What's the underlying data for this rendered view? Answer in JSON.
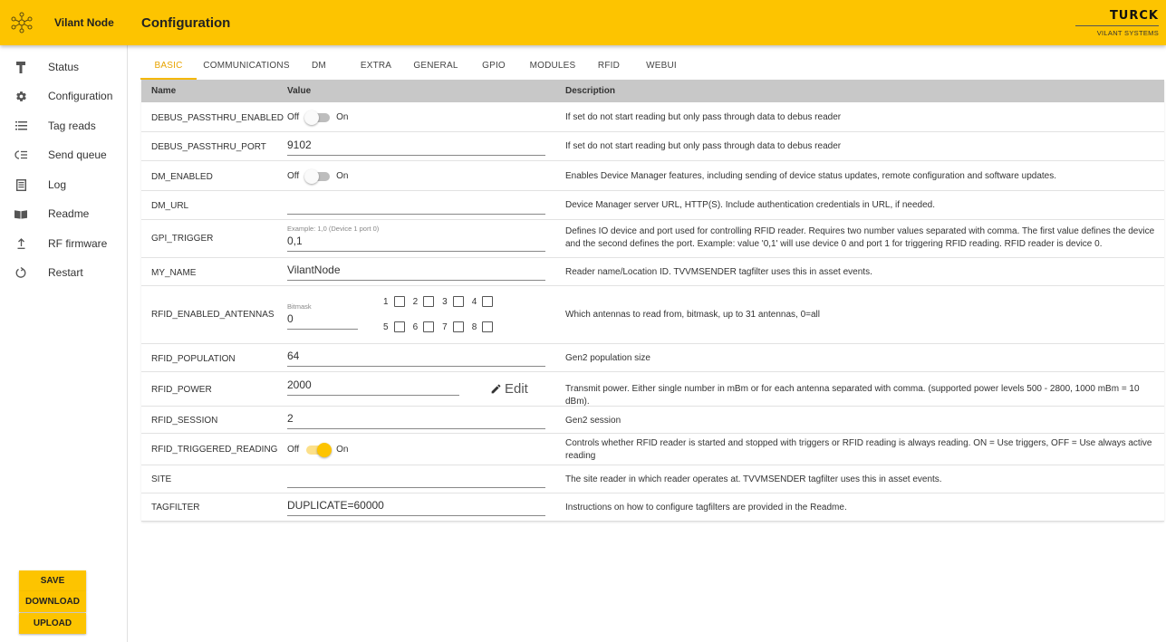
{
  "header": {
    "app_name": "Vilant Node",
    "page_title": "Configuration",
    "brand_main": "TURCK",
    "brand_sub": "VILANT SYSTEMS",
    "accent": "#fdc400"
  },
  "sidebar": {
    "items": [
      {
        "label": "Status",
        "icon": "hammer-icon"
      },
      {
        "label": "Configuration",
        "icon": "gear-icon"
      },
      {
        "label": "Tag reads",
        "icon": "list-icon"
      },
      {
        "label": "Send queue",
        "icon": "queue-icon"
      },
      {
        "label": "Log",
        "icon": "document-icon"
      },
      {
        "label": "Readme",
        "icon": "book-icon"
      },
      {
        "label": "RF firmware",
        "icon": "upload-arrow-icon"
      },
      {
        "label": "Restart",
        "icon": "restart-icon"
      }
    ],
    "buttons": {
      "save": "SAVE",
      "download": "DOWNLOAD",
      "upload": "UPLOAD"
    }
  },
  "tabs": [
    "BASIC",
    "COMMUNICATIONS",
    "DM",
    "EXTRA",
    "GENERAL",
    "GPIO",
    "MODULES",
    "RFID",
    "WEBUI"
  ],
  "active_tab": "BASIC",
  "table": {
    "headers": {
      "name": "Name",
      "value": "Value",
      "description": "Description"
    },
    "rows": {
      "debus_passthru_enabled": {
        "name": "DEBUS_PASSTHRU_ENABLED",
        "off_label": "Off",
        "on_label": "On",
        "state": "off",
        "description": "If set do not start reading but only pass through data to debus reader"
      },
      "debus_passthru_port": {
        "name": "DEBUS_PASSTHRU_PORT",
        "value": "9102",
        "description": "If set do not start reading but only pass through data to debus reader"
      },
      "dm_enabled": {
        "name": "DM_ENABLED",
        "off_label": "Off",
        "on_label": "On",
        "state": "off",
        "description": "Enables Device Manager features, including sending of device status updates, remote configuration and software updates."
      },
      "dm_url": {
        "name": "DM_URL",
        "value": "",
        "description": "Device Manager server URL, HTTP(S). Include authentication credentials in URL, if needed."
      },
      "gpi_trigger": {
        "name": "GPI_TRIGGER",
        "hint": "Example: 1,0 (Device 1 port 0)",
        "value": "0,1",
        "description": "Defines IO device and port used for controlling RFID reader. Requires two number values separated with comma. The first value defines the device and the second defines the port. Example: value '0,1' will use device 0 and port 1 for triggering RFID reading. RFID reader is device 0."
      },
      "my_name": {
        "name": "MY_NAME",
        "value": "VilantNode",
        "description": "Reader name/Location ID. TVVMSENDER tagfilter uses this in asset events."
      },
      "rfid_enabled_antennas": {
        "name": "RFID_ENABLED_ANTENNAS",
        "hint": "Bitmask",
        "value": "0",
        "antennas": [
          "1",
          "2",
          "3",
          "4",
          "5",
          "6",
          "7",
          "8"
        ],
        "description": "Which antennas to read from, bitmask, up to 31 antennas, 0=all"
      },
      "rfid_population": {
        "name": "RFID_POPULATION",
        "value": "64",
        "description": "Gen2 population size"
      },
      "rfid_power": {
        "name": "RFID_POWER",
        "value": "2000",
        "edit_label": "Edit",
        "description": "Transmit power. Either single number in mBm or for each antenna separated with comma. (supported power levels 500 - 2800, 1000 mBm = 10 dBm)."
      },
      "rfid_session": {
        "name": "RFID_SESSION",
        "value": "2",
        "description": "Gen2 session"
      },
      "rfid_triggered_reading": {
        "name": "RFID_TRIGGERED_READING",
        "off_label": "Off",
        "on_label": "On",
        "state": "on",
        "description": "Controls whether RFID reader is started and stopped with triggers or RFID reading is always reading. ON = Use triggers, OFF = Use always active reading"
      },
      "site": {
        "name": "SITE",
        "value": "",
        "description": "The site reader in which reader operates at. TVVMSENDER tagfilter uses this in asset events."
      },
      "tagfilter": {
        "name": "TAGFILTER",
        "value": "DUPLICATE=60000",
        "description": "Instructions on how to configure tagfilters are provided in the Readme."
      }
    }
  }
}
